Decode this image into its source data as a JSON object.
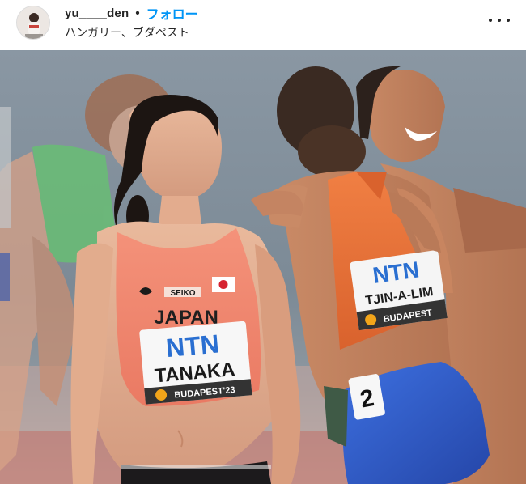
{
  "post": {
    "username": "yu____den",
    "separator": "•",
    "follow_label": "フォロー",
    "location": "ハンガリー、ブダペスト"
  },
  "icons": {
    "more": "more-options-icon",
    "avatar": "profile-avatar"
  },
  "colors": {
    "follow_blue": "#0095f6",
    "text_dark": "#262626",
    "japan_top": "#f2876f",
    "netherlands_top": "#ee7a3c",
    "italy_shorts": "#2f5fd1",
    "track_red": "#c6645a"
  },
  "photo": {
    "athlete_left": {
      "country": "JAPAN",
      "sponsor": "NTN",
      "name": "TANAKA",
      "event": "BUDAPEST'23",
      "brand": "SEIKO"
    },
    "athlete_right": {
      "sponsor": "NTN",
      "name": "TJIN-A-LIM",
      "event": "BUDAPEST"
    },
    "hip_number": "2"
  }
}
